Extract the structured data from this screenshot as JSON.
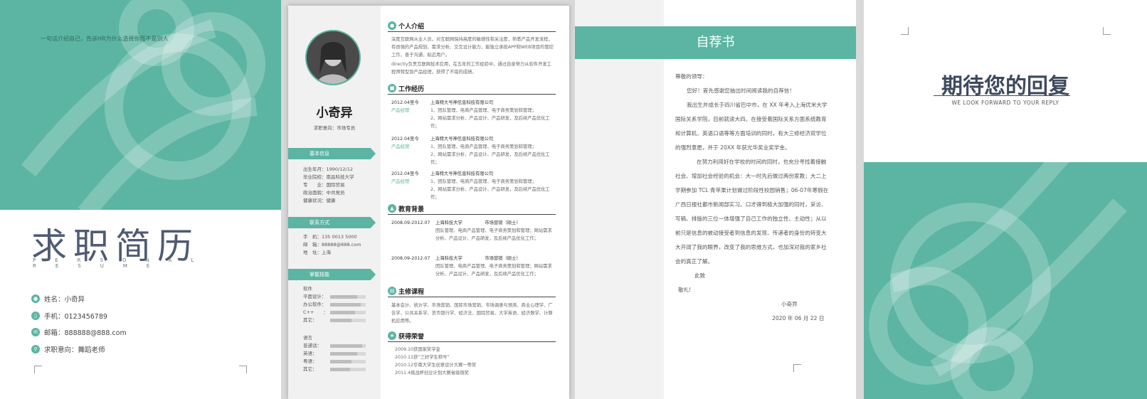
{
  "cover": {
    "tagline": "一句话介绍自己，告诉HR为什么选择你而不是别人",
    "title": "求职简历",
    "subtitle": "PERSONAL RESUME",
    "info": [
      {
        "icon": "person-icon",
        "text": "姓名：小奇异"
      },
      {
        "icon": "phone-icon",
        "text": "手机：0123456789"
      },
      {
        "icon": "mail-icon",
        "text": "邮箱：888888@888.com"
      },
      {
        "icon": "search-icon",
        "text": "求职意向：舞蹈老师"
      }
    ]
  },
  "resume": {
    "name": "小奇异",
    "job": "求职意向：市场专员",
    "basic_title": "基本信息",
    "basic": [
      "出生年月：1990/12/12",
      "毕业院校：南昌科技大学",
      "专　　业：国际贸易",
      "政治面貌：中共党员",
      "健康状况：健康"
    ],
    "contact_title": "联系方式",
    "contact": [
      "手　机：135 0013 5000",
      "邮　箱：88888@888.com",
      "地　址：上海"
    ],
    "skills_title": "掌握技能",
    "software_label": "软件",
    "software": [
      {
        "name": "平面设计：",
        "level": 0.75
      },
      {
        "name": "办公软件：",
        "level": 0.85
      },
      {
        "name": "C++　　：",
        "level": 0.7
      },
      {
        "name": "其它：",
        "level": 0.6
      }
    ],
    "language_label": "语言",
    "languages": [
      {
        "name": "普通话：",
        "level": 0.9
      },
      {
        "name": "英语：",
        "level": 0.75
      },
      {
        "name": "粤语：",
        "level": 0.6
      },
      {
        "name": "其它：",
        "level": 0.55
      }
    ],
    "intro_title": "个人介绍",
    "intro": [
      "深度互联网从业人员，对互联网保持高度的敏感性和关注度，熟悉产品开发流程，有很强的产品规划、需求分析、交互设计能力，能独立承担APP和WEB项目的管控工作，善于沟通，贴近用户。",
      "directly负责互联网技术应用，在五年的工作经验中，通过自身努力从软件开发工程师转型到产品经理，获得了不错的成绩。"
    ],
    "work_title": "工作经历",
    "work": [
      {
        "date": "2012.04至今",
        "role": "产品经理",
        "company": "上海特大号神信息科技有限公司",
        "duties": [
          "1、团队管理、电商产品管理、电子商务策划和管理；",
          "2、网站需求分析、产品设计、产品研发，及后续产品优化工作；"
        ]
      },
      {
        "date": "2012.04至今",
        "role": "产品经理",
        "company": "上海特大号神信息科技有限公司",
        "duties": [
          "1、团队管理、电商产品管理、电子商务策划和管理；",
          "2、网站需求分析、产品设计、产品研发，及后续产品优化工作；"
        ]
      },
      {
        "date": "2012.04至今",
        "role": "产品经理",
        "company": "上海特大号神信息科技有限公司",
        "duties": [
          "1、团队管理、电商产品管理、电子商务策划和管理；",
          "2、网站需求分析、产品设计、产品研发，及后续产品优化工作；"
        ]
      }
    ],
    "edu_title": "教育背景",
    "edu": [
      {
        "date": "2008.09-2012.07",
        "school": "上海科技大学",
        "major": "市场营销（硕士）",
        "desc": "团队管理、电商产品管理、电子商务策划和管理；网站需求分析、产品设计、产品研发，及后续产品优化工作；"
      },
      {
        "date": "2008.09-2012.07",
        "school": "上海科技大学",
        "major": "市场营销（硕士）",
        "desc": "团队管理、电商产品管理、电子商务策划和管理；网站需求分析、产品设计、产品研发，及后续产品优化工作；"
      }
    ],
    "course_title": "主修课程",
    "courses": "基本会计、统计学、市场营销、国际市场营销、市场调查与预测、商业心理学、广告学、公共关系学、货币银行学、经济法、国际贸易、大学英语、经济数学、计算机应用等。",
    "honor_title": "获得荣誉",
    "honors": [
      "2009.10获国家奖学金",
      "2010.11获“三好学生称号”",
      "2010.12华南大学生创意设计大赛一等奖",
      "2011.4挑战杯创业计划大赛省级铜奖"
    ]
  },
  "letter": {
    "title": "自荐书",
    "greeting": "尊敬的领导：",
    "p1": "您好！首先感谢您抽出时间阅读我的自荐信！",
    "p2": "我出生并成长于四川省巴中市，在 XX 年考入上海优米大学国际关系学院，目前就读大四。在接受着国际关系方面系统教育和计算机、英语口语等等方面培训的同时，有大三修经济双学位的强烈意愿，并于 20XX 年获光华奖业奖学金。",
    "p3": "在努力利用好在学校的时间的同时，也充分寻找着接触社会、增加社会经验的机会：大一时先后做过两份家教；大二上学期参加 TCL 青苹果计划做过阶段性校园销售；06-07年寒假在广西日报社都市新闻部实习。口才得到极大加强的同时，采访、写稿、排版的三位一体增强了自己工作的独立性、主动性；从以前只是信息的被动接受者到信息的发现、传递者的身份的转变大大开阔了我的眼界，改变了我的思维方式，也加深对我的家乡社会的真正了解。",
    "closing1": "此致",
    "closing2": "敬礼!",
    "signer": "小奇异",
    "date": "2020 年 06 月 22 日"
  },
  "back": {
    "title": "期待您的回复",
    "subtitle": "WE LOOK FORWARD TO YOUR REPLY"
  },
  "colors": {
    "accent": "#5bb5a2",
    "dark": "#3f4a5f"
  }
}
